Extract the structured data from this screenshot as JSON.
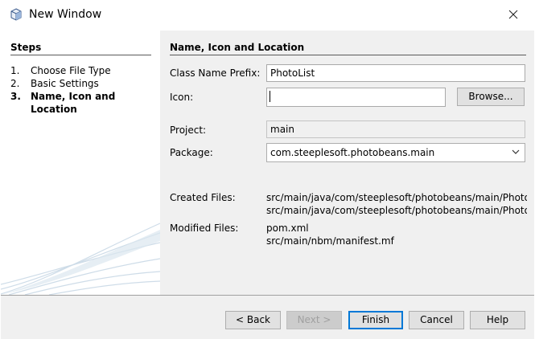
{
  "window": {
    "title": "New Window",
    "icon": "netbeans-cube-icon",
    "close_icon": "close-icon"
  },
  "steps": {
    "title": "Steps",
    "items": [
      {
        "num": "1.",
        "label": "Choose File Type"
      },
      {
        "num": "2.",
        "label": "Basic Settings"
      },
      {
        "num": "3.",
        "label": "Name, Icon and Location"
      }
    ],
    "current_index": 2
  },
  "panel": {
    "title": "Name, Icon and Location",
    "class_name_prefix": {
      "label": "Class Name Prefix:",
      "value": "PhotoList"
    },
    "icon": {
      "label": "Icon:",
      "value": "",
      "browse_label": "Browse..."
    },
    "project": {
      "label": "Project:",
      "value": "main"
    },
    "package": {
      "label": "Package:",
      "value": "com.steeplesoft.photobeans.main"
    },
    "created_files": {
      "label": "Created Files:",
      "values": [
        "src/main/java/com/steeplesoft/photobeans/main/PhotoL",
        "src/main/java/com/steeplesoft/photobeans/main/PhotoL"
      ]
    },
    "modified_files": {
      "label": "Modified Files:",
      "values": [
        "pom.xml",
        "src/main/nbm/manifest.mf"
      ]
    }
  },
  "buttons": {
    "back": "< Back",
    "next": "Next >",
    "finish": "Finish",
    "cancel": "Cancel",
    "help": "Help"
  },
  "colors": {
    "accent": "#0078d7",
    "dialog_bg": "#f0f0f0",
    "disabled_text": "#a0a0a0"
  }
}
